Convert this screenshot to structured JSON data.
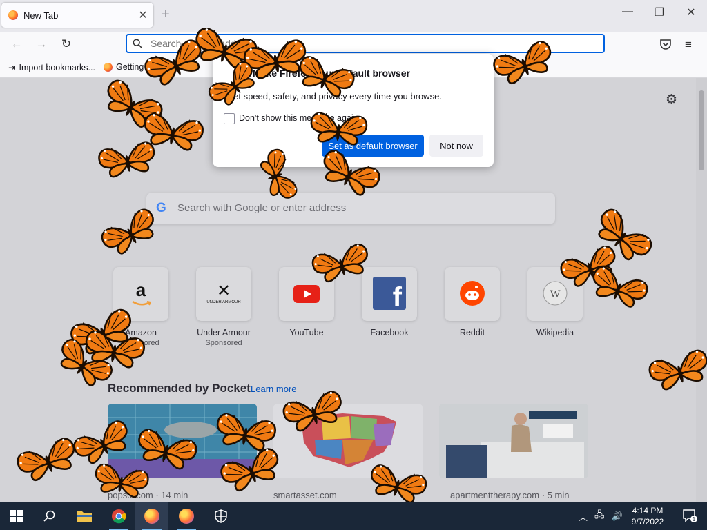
{
  "browser": {
    "tab_title": "New Tab",
    "tab_close": "✕",
    "new_tab": "+",
    "window_controls": {
      "minimize": "—",
      "maximize": "❐",
      "close": "✕"
    },
    "nav": {
      "back": "←",
      "forward": "→",
      "reload": "↻"
    },
    "urlbar_placeholder": "Search or enter address",
    "menu": "≡",
    "bookmarks": [
      {
        "label": "Import bookmarks...",
        "icon": "import-icon"
      },
      {
        "label": "Getting Started",
        "icon": "firefox-icon"
      }
    ]
  },
  "newtab": {
    "search_placeholder": "Search with Google or enter address",
    "settings_icon": "gear-icon",
    "top_sites": [
      {
        "label": "Amazon",
        "sub": "Sponsored",
        "icon": "amazon-logo"
      },
      {
        "label": "Under Armour",
        "sub": "Sponsored",
        "icon": "under-armour-logo"
      },
      {
        "label": "YouTube",
        "sub": "",
        "icon": "youtube-logo"
      },
      {
        "label": "Facebook",
        "sub": "",
        "icon": "facebook-logo"
      },
      {
        "label": "Reddit",
        "sub": "",
        "icon": "reddit-logo"
      },
      {
        "label": "Wikipedia",
        "sub": "",
        "icon": "wikipedia-logo"
      }
    ],
    "pocket_heading": "Recommended by Pocket",
    "learn_more": "Learn more",
    "pocket_cards": [
      {
        "source": "popsci.com · 14 min"
      },
      {
        "source": "smartasset.com"
      },
      {
        "source": "apartmenttherapy.com · 5 min"
      }
    ]
  },
  "dialog": {
    "title": "Make Firefox your default browser",
    "body": "Get speed, safety, and privacy every time you browse.",
    "checkbox_label": "Don't show this message again",
    "primary_button": "Set as default browser",
    "secondary_button": "Not now"
  },
  "taskbar": {
    "apps": [
      "windows-start",
      "search",
      "file-explorer",
      "chrome",
      "firefox",
      "firefox",
      "windows-security"
    ],
    "time": "4:14 PM",
    "date": "9/7/2022",
    "notification_count": "1"
  },
  "colors": {
    "accent": "#0061e0",
    "butterfly_orange": "#f07a12"
  }
}
